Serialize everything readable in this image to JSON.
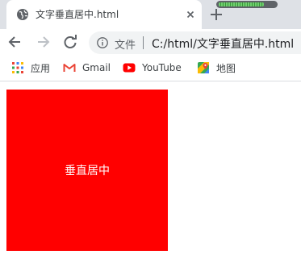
{
  "tab": {
    "title": "文字垂直居中.html",
    "favicon": "globe-icon"
  },
  "loading_progress": 0.8,
  "toolbar": {
    "back": "arrow-left-icon",
    "forward": "arrow-right-icon",
    "reload": "reload-icon"
  },
  "omnibox": {
    "security_label": "文件",
    "url": "C:/html/文字垂直居中.html"
  },
  "bookmarks": [
    {
      "label": "应用",
      "icon": "apps-grid-icon"
    },
    {
      "label": "Gmail",
      "icon": "gmail-icon"
    },
    {
      "label": "YouTube",
      "icon": "youtube-icon"
    },
    {
      "label": "地图",
      "icon": "maps-icon"
    }
  ],
  "page": {
    "box_text": "垂直居中",
    "box_color": "#ff0000"
  }
}
